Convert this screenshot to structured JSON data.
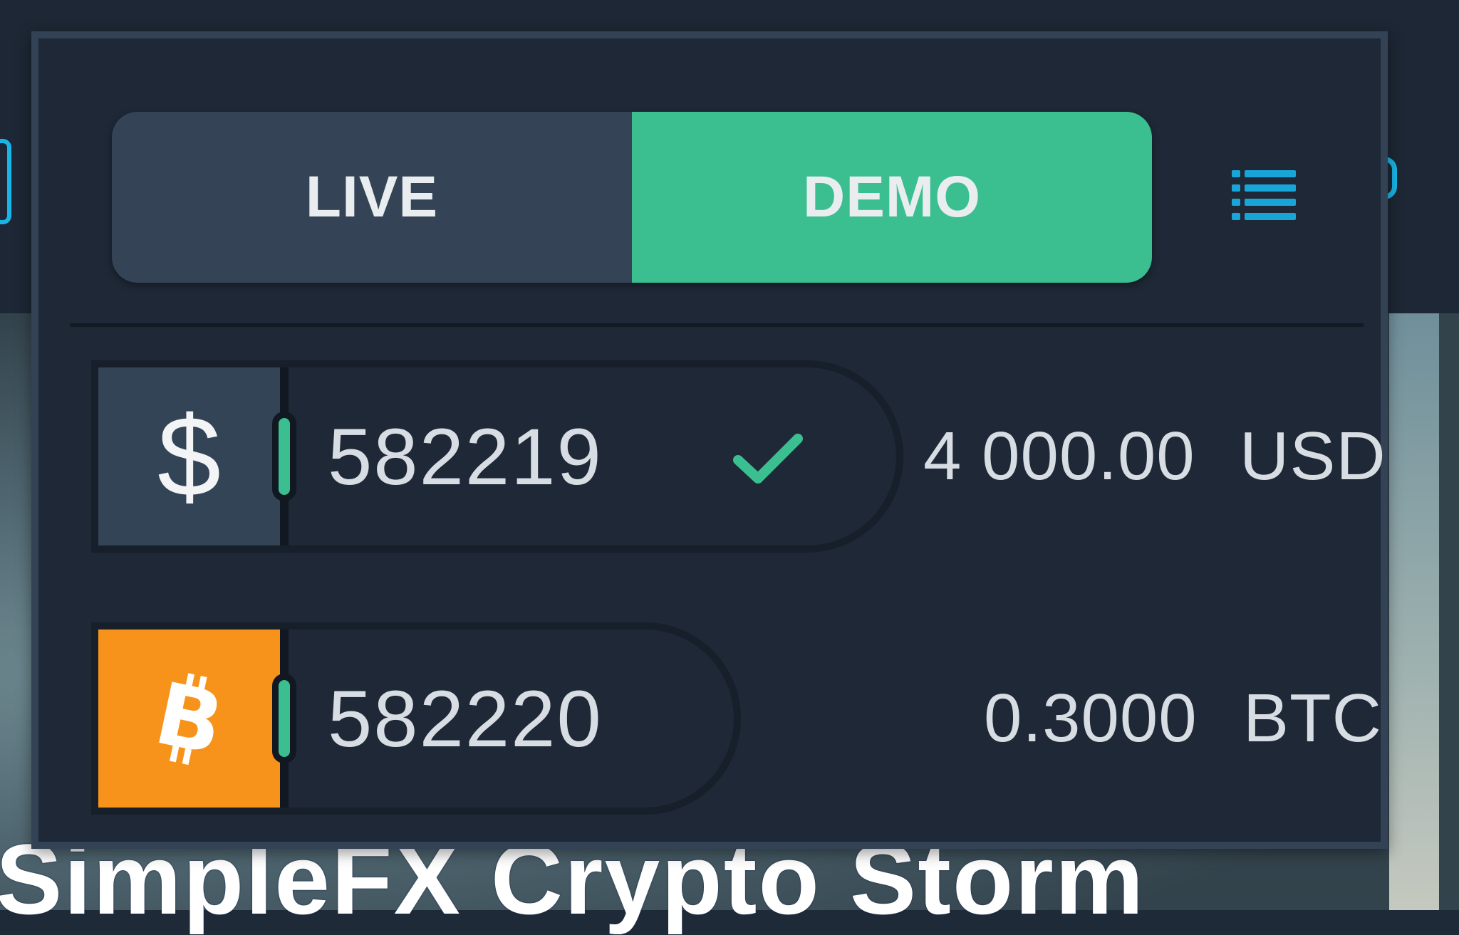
{
  "background": {
    "title": "SimpleFX Crypto Storm"
  },
  "mode_toggle": {
    "live_label": "LIVE",
    "demo_label": "DEMO",
    "selected": "DEMO"
  },
  "menu": {
    "icon": "list-icon"
  },
  "accounts": [
    {
      "currency_icon": "dollar-icon",
      "currency_symbol": "$",
      "account_id": "582219",
      "selected": true,
      "balance": "4 000.00",
      "currency_code": "USD"
    },
    {
      "currency_icon": "bitcoin-icon",
      "currency_symbol": "₿",
      "account_id": "582220",
      "selected": false,
      "balance": "0.3000",
      "currency_code": "BTC"
    }
  ],
  "colors": {
    "panel_bg": "#1e2836",
    "panel_border": "#334255",
    "live_bg": "#344456",
    "demo_bg": "#3bbf90",
    "accent_green": "#3bbf90",
    "accent_blue": "#18b6e8",
    "btc_orange": "#f7931a",
    "text": "#d7dde3"
  }
}
